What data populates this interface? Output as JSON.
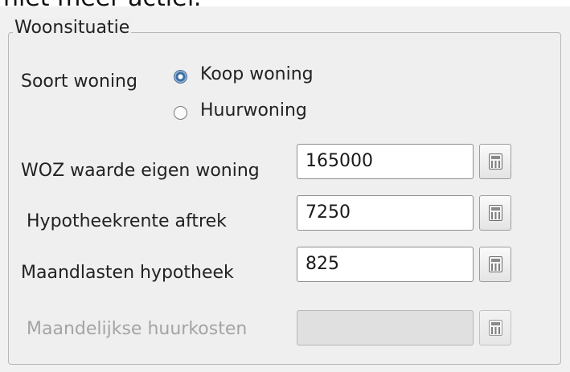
{
  "top_clipped_text": "niet meer actief.",
  "group": {
    "title": "Woonsituatie",
    "soort_woning": {
      "label": "Soort woning",
      "options": [
        {
          "label": "Koop woning",
          "checked": true
        },
        {
          "label": "Huurwoning",
          "checked": false
        }
      ]
    },
    "fields": [
      {
        "label": "WOZ waarde eigen woning",
        "value": "165000",
        "enabled": true
      },
      {
        "label": "Hypotheekrente aftrek",
        "value": "7250",
        "enabled": true
      },
      {
        "label": "Maandlasten hypotheek",
        "value": "825",
        "enabled": true
      },
      {
        "label": "Maandelijkse huurkosten",
        "value": "",
        "enabled": false
      }
    ]
  },
  "icons": {
    "calculator": "calculator-icon"
  }
}
